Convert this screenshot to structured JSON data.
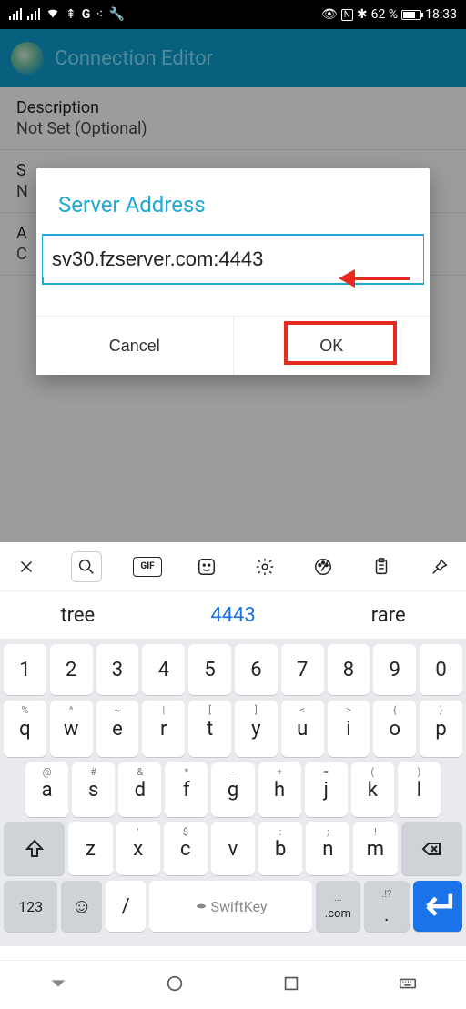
{
  "status": {
    "battery_pct": "62 %",
    "time": "18:33"
  },
  "appbar": {
    "title": "Connection Editor"
  },
  "bg_fields": {
    "desc_label": "Description",
    "desc_value": "Not Set (Optional)",
    "server_label_partial": "S",
    "server_value_partial": "N",
    "adv_label_partial": "A",
    "adv_value_partial": "C"
  },
  "dialog": {
    "title": "Server Address",
    "input_value": "sv30.fzserver.com:4443",
    "cancel": "Cancel",
    "ok": "OK"
  },
  "suggestions": {
    "s1": "tree",
    "s2": "4443",
    "s3": "rare"
  },
  "keys": {
    "row1": [
      "1",
      "2",
      "3",
      "4",
      "5",
      "6",
      "7",
      "8",
      "9",
      "0"
    ],
    "row2_sup": [
      "%",
      "^",
      "~",
      "|",
      "[",
      "]",
      "<",
      ">",
      "{",
      "}"
    ],
    "row2": [
      "q",
      "w",
      "e",
      "r",
      "t",
      "y",
      "u",
      "i",
      "o",
      "p"
    ],
    "row3_sup": [
      "@",
      "#",
      "&",
      "*",
      "-",
      "+",
      "=",
      "(",
      ")"
    ],
    "row3": [
      "a",
      "s",
      "d",
      "f",
      "g",
      "h",
      "j",
      "k",
      "l"
    ],
    "row4_sup": [
      "",
      "'",
      "$",
      "",
      ":",
      ";",
      "!",
      "?"
    ],
    "row4": [
      "z",
      "x",
      "c",
      "v",
      "b",
      "n",
      "m"
    ],
    "num": "123",
    "slash": "/",
    "space": "SwiftKey",
    "dotcom_sup": "...",
    "dotcom": ".com",
    "period_sup": ".!?",
    "period": "."
  },
  "toolbar_labels": {
    "gif": "GIF"
  }
}
